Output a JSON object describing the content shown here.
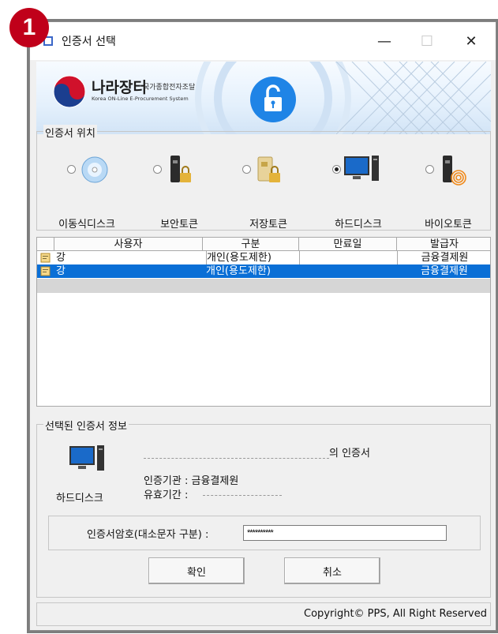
{
  "step_badge": "1",
  "window": {
    "title": "인증서 선택",
    "minimize_icon": "minimize-icon",
    "maximize_icon": "maximize-icon",
    "close_icon": "close-icon"
  },
  "banner": {
    "logo_text": "나라장터",
    "logo_subtext": "국가종합전자조달",
    "logo_english": "Korea ON-Line E-Procurement System",
    "lock_icon": "unlock-icon"
  },
  "location": {
    "group_label": "인증서 위치",
    "options": [
      {
        "label": "이동식디스크",
        "icon": "cd-disk-icon",
        "selected": false
      },
      {
        "label": "보안토큰",
        "icon": "security-token-icon",
        "selected": false
      },
      {
        "label": "저장토큰",
        "icon": "storage-token-icon",
        "selected": false
      },
      {
        "label": "하드디스크",
        "icon": "hard-disk-computer-icon",
        "selected": true
      },
      {
        "label": "바이오토큰",
        "icon": "bio-token-icon",
        "selected": false
      }
    ]
  },
  "cert_table": {
    "headers": [
      "사용자",
      "구분",
      "만료일",
      "발급자"
    ],
    "rows": [
      {
        "user": "강",
        "type": "개인(용도제한)",
        "expiry": "",
        "issuer": "금융결제원",
        "selected": false
      },
      {
        "user": "강",
        "type": "개인(용도제한)",
        "expiry": "",
        "issuer": "금융결제원",
        "selected": true
      }
    ]
  },
  "cert_info": {
    "group_label": "선택된 인증서 정보",
    "device_label": "하드디스크",
    "owner_suffix": "의 인증서",
    "issuer_line": "인증기관 : 금융결제원",
    "validity_label": "유효기간 :"
  },
  "password": {
    "label": "인증서암호(대소문자 구분) :",
    "value": "**********"
  },
  "buttons": {
    "confirm": "확인",
    "cancel": "취소"
  },
  "status_bar": "Copyright© PPS, All Right Reserved"
}
